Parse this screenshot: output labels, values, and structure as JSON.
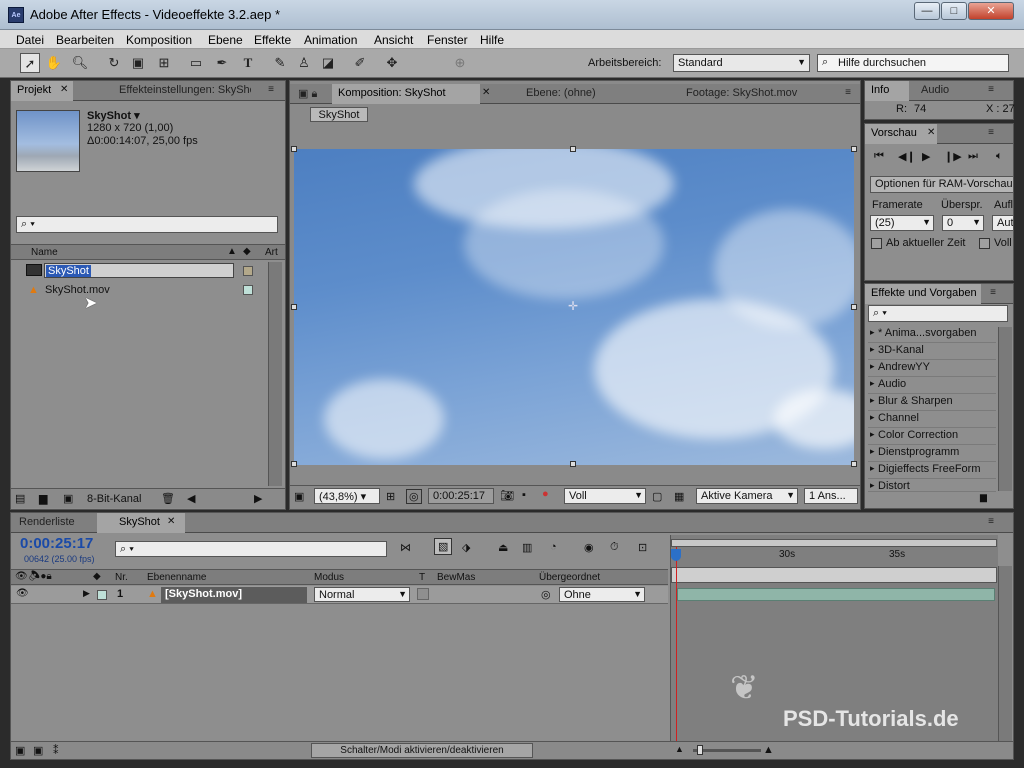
{
  "window": {
    "title": "Adobe After Effects - Videoeffekte 3.2.aep *",
    "app_icon": "Ae",
    "minimize": "—",
    "maximize": "□",
    "close": "✕"
  },
  "menu": [
    "Datei",
    "Bearbeiten",
    "Komposition",
    "Ebene",
    "Effekte",
    "Animation",
    "Ansicht",
    "Fenster",
    "Hilfe"
  ],
  "toolbar": {
    "workspace_label": "Arbeitsbereich:",
    "workspace_value": "Standard",
    "help_placeholder": "Hilfe durchsuchen",
    "tools": [
      "selection-tool",
      "hand-tool",
      "zoom-tool",
      "rotate-tool",
      "camera-tool",
      "pan-behind-tool",
      "rectangle-tool",
      "pen-tool",
      "text-tool",
      "brush-tool",
      "clone-stamp-tool",
      "eraser-tool",
      "roto-brush-tool",
      "puppet-tool"
    ]
  },
  "project": {
    "tab_project": "Projekt",
    "tab_effects": "Effekteinstellungen: SkyShot",
    "item_name": "SkyShot ▾",
    "item_size": "1280 x 720 (1,00)",
    "item_duration": "Δ0:00:14:07, 25,00 fps",
    "col_name": "Name",
    "col_type": "Art",
    "items": [
      {
        "name": "SkyShot",
        "selected": true,
        "label_color": "#b3a88a"
      },
      {
        "name": "SkyShot.mov",
        "selected": false,
        "label_color": "#bfe0d8"
      }
    ],
    "bit_depth": "8-Bit-Kanal"
  },
  "viewer": {
    "tab_comp": "Komposition: SkyShot",
    "tab_layer": "Ebene: (ohne)",
    "tab_footage": "Footage: SkyShot.mov",
    "comp_button": "SkyShot",
    "zoom": "(43,8%)",
    "timecode": "0:00:25:17",
    "resolution": "Voll",
    "camera": "Aktive Kamera",
    "views": "1 Ans..."
  },
  "info": {
    "tab_info": "Info",
    "tab_audio": "Audio",
    "r_label": "R:",
    "r_value": "74",
    "x_label": "X : 27"
  },
  "preview": {
    "tab": "Vorschau",
    "ram_options": "Optionen für RAM-Vorschau",
    "framerate_label": "Framerate",
    "skip_label": "Überspr.",
    "res_label": "Aufl",
    "framerate_value": "(25)",
    "skip_value": "0",
    "res_value": "Aut",
    "from_current": "Ab aktueller Zeit",
    "full_screen": "Voll"
  },
  "effects": {
    "tab": "Effekte und Vorgaben",
    "categories": [
      "* Anima...svorgaben",
      "3D-Kanal",
      "AndrewYY",
      "Audio",
      "Blur & Sharpen",
      "Channel",
      "Color Correction",
      "Dienstprogramm",
      "Digieffects FreeForm",
      "Distort"
    ]
  },
  "timeline": {
    "tab_render": "Renderliste",
    "tab_comp": "SkyShot",
    "timecode": "0:00:25:17",
    "frame_info": "00642 (25.00 fps)",
    "col_nr": "Nr.",
    "col_layer": "Ebenenname",
    "col_mode": "Modus",
    "col_t": "T",
    "col_trkmat": "BewMas",
    "col_parent": "Übergeordnet",
    "layer_nr": "1",
    "layer_name": "[SkyShot.mov]",
    "layer_mode": "Normal",
    "layer_parent": "Ohne",
    "layer_label_color": "#bfe0d8",
    "ruler": [
      "30s",
      "35s"
    ],
    "toggle_label": "Schalter/Modi aktivieren/deaktivieren"
  },
  "watermark": "PSD-Tutorials.de",
  "colors": {
    "panel": "#8e8e8e",
    "selection": "#2b59b5",
    "timecode": "#1a4aa8",
    "layer_bar": "#8fb5a8",
    "playhead": "#d02020"
  }
}
